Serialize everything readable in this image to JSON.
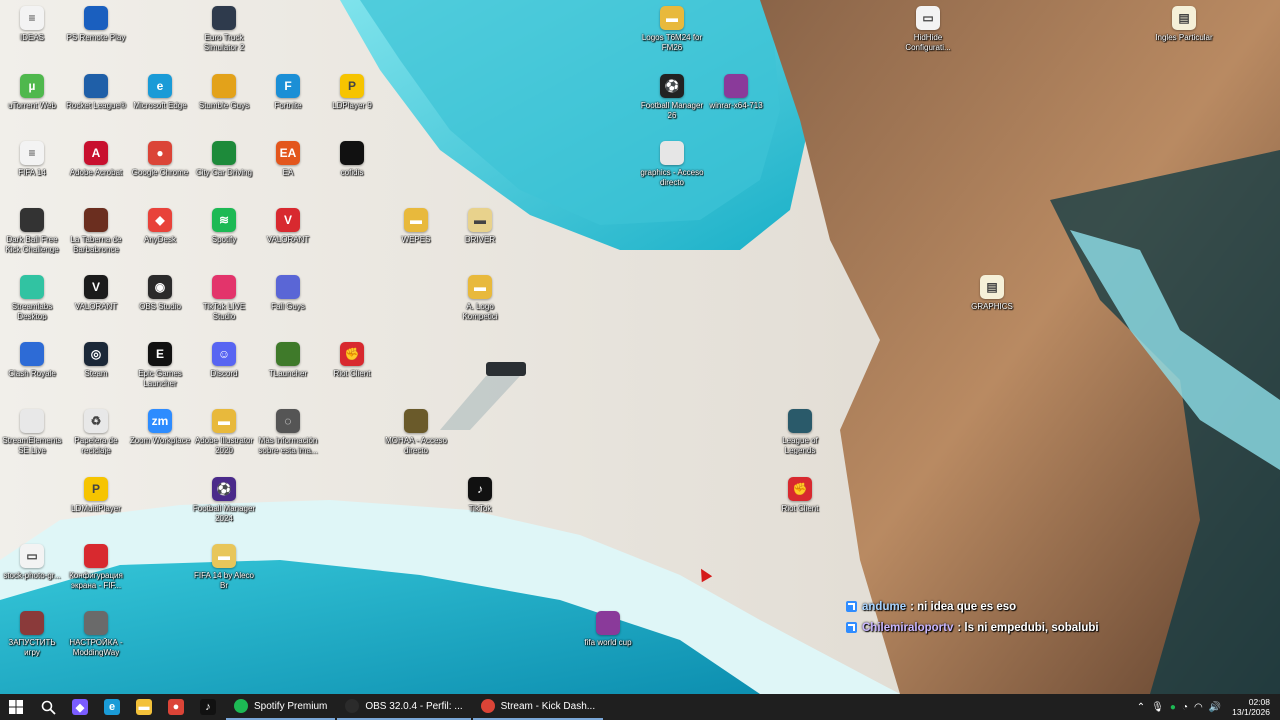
{
  "desktop": {
    "icons": [
      {
        "label": "IDEAS",
        "icon": "text-file-icon",
        "color": "#f3f3f3"
      },
      {
        "label": "PS Remote Play",
        "icon": "ps-remote-play-icon",
        "color": "#1a5fbf"
      },
      {
        "label": "Euro Truck Simulator 2",
        "icon": "euro-truck-icon",
        "color": "#2e3a4c"
      },
      {
        "label": "Logos T6M24 for FM26",
        "icon": "folder-icon",
        "color": "#e8b93c"
      },
      {
        "label": "HidHide Configurati...",
        "icon": "file-icon",
        "color": "#f3f3f3"
      },
      {
        "label": "Ingles Particular",
        "icon": "document-icon",
        "color": "#f5f0d8"
      },
      {
        "label": "uTorrent Web",
        "icon": "utorrent-icon",
        "color": "#4fb84d"
      },
      {
        "label": "Rocket League®",
        "icon": "rocket-league-icon",
        "color": "#1f5fa8"
      },
      {
        "label": "Microsoft Edge",
        "icon": "edge-icon",
        "color": "#1a9bd7"
      },
      {
        "label": "Stumble Guys",
        "icon": "stumble-guys-icon",
        "color": "#e3a21a"
      },
      {
        "label": "Fortnite",
        "icon": "fortnite-icon",
        "color": "#1b8fd6"
      },
      {
        "label": "LDPlayer 9",
        "icon": "ldplayer-icon",
        "color": "#f6c400"
      },
      {
        "label": "Football Manager 26",
        "icon": "football-manager-icon",
        "color": "#222222"
      },
      {
        "label": "winrar-x64-713",
        "icon": "winrar-icon",
        "color": "#8a3a9a"
      },
      {
        "label": "FIFA 14",
        "icon": "text-file-icon",
        "color": "#f3f3f3"
      },
      {
        "label": "Adobe Acrobat",
        "icon": "acrobat-icon",
        "color": "#c8102e"
      },
      {
        "label": "Google Chrome",
        "icon": "chrome-icon",
        "color": "#db4437"
      },
      {
        "label": "City Car Driving",
        "icon": "city-car-icon",
        "color": "#1d8a3a"
      },
      {
        "label": "EA",
        "icon": "ea-icon",
        "color": "#e3561c"
      },
      {
        "label": "cofidis",
        "icon": "phone-file-icon",
        "color": "#111111"
      },
      {
        "label": "graphics - Acceso directo",
        "icon": "shortcut-icon",
        "color": "#e6e6e6"
      },
      {
        "label": "Dark Ball Free Kick Challenge",
        "icon": "ball-icon",
        "color": "#333333"
      },
      {
        "label": "La Taberna de Barbabronce",
        "icon": "taberna-icon",
        "color": "#6b2e1f"
      },
      {
        "label": "AnyDesk",
        "icon": "anydesk-icon",
        "color": "#e8423a"
      },
      {
        "label": "Spotify",
        "icon": "spotify-icon",
        "color": "#1db954"
      },
      {
        "label": "VALORANT",
        "icon": "valorant-icon",
        "color": "#d8292f"
      },
      {
        "label": "WEPES",
        "icon": "folder-icon",
        "color": "#e8b93c"
      },
      {
        "label": "DRIVER",
        "icon": "folder-icon",
        "color": "#e8d28c"
      },
      {
        "label": "Streamlabs Desktop",
        "icon": "streamlabs-icon",
        "color": "#31c3a2"
      },
      {
        "label": "VALORANT",
        "icon": "valorant-icon",
        "color": "#1b1b1b"
      },
      {
        "label": "OBS Studio",
        "icon": "obs-icon",
        "color": "#2b2b2b"
      },
      {
        "label": "TikTok LIVE Studio",
        "icon": "tiktok-live-icon",
        "color": "#e3346b"
      },
      {
        "label": "Fall Guys",
        "icon": "fall-guys-icon",
        "color": "#5a66d6"
      },
      {
        "label": "A. Logo Kompetici",
        "icon": "folder-icon",
        "color": "#e8b93c"
      },
      {
        "label": "GRAPHICS",
        "icon": "document-icon",
        "color": "#f5f0d8"
      },
      {
        "label": "Clash Royale",
        "icon": "clash-royale-icon",
        "color": "#2d6bd6"
      },
      {
        "label": "Steam",
        "icon": "steam-icon",
        "color": "#1b2838"
      },
      {
        "label": "Epic Games Launcher",
        "icon": "epic-games-icon",
        "color": "#111111"
      },
      {
        "label": "Discord",
        "icon": "discord-icon",
        "color": "#5865f2"
      },
      {
        "label": "TLauncher",
        "icon": "tlauncher-icon",
        "color": "#3f7a2a"
      },
      {
        "label": "Riot Client",
        "icon": "riot-client-icon",
        "color": "#d8292f"
      },
      {
        "label": "StreamElements SE.Live",
        "icon": "streamelements-icon",
        "color": "#e8e8e8"
      },
      {
        "label": "Papelera de reciclaje",
        "icon": "recycle-bin-icon",
        "color": "#e8e8e8"
      },
      {
        "label": "Zoom Workplace",
        "icon": "zoom-icon",
        "color": "#2d8cff"
      },
      {
        "label": "Adobe Illustrator 2020",
        "icon": "folder-icon",
        "color": "#e8b93c"
      },
      {
        "label": "Más información sobre esta ima...",
        "icon": "camera-icon",
        "color": "#555555"
      },
      {
        "label": "MOHAA - Acceso directo",
        "icon": "mohaa-icon",
        "color": "#6a5a2a"
      },
      {
        "label": "League of Legends",
        "icon": "league-icon",
        "color": "#2a5a6a"
      },
      {
        "label": "LDMultiPlayer",
        "icon": "ldmultiplayer-icon",
        "color": "#f6c400"
      },
      {
        "label": "Football Manager 2024",
        "icon": "football-manager-icon",
        "color": "#4a2a8a"
      },
      {
        "label": "TikTok",
        "icon": "tiktok-icon",
        "color": "#111111"
      },
      {
        "label": "Riot Client",
        "icon": "riot-client-icon",
        "color": "#d8292f"
      },
      {
        "label": "stock-photo-gr...",
        "icon": "file-icon",
        "color": "#f3f3f3"
      },
      {
        "label": "Конфигурация экрана - FIF...",
        "icon": "fifa-config-icon",
        "color": "#d8292f"
      },
      {
        "label": "FIFA 14 by Aleco Br",
        "icon": "folder-icon",
        "color": "#e8c65a"
      },
      {
        "label": "ЗАПУСТИТЬ игру",
        "icon": "launch-game-icon",
        "color": "#8a3a3a"
      },
      {
        "label": "НАСТРОЙКА - ModdingWay",
        "icon": "settings-app-icon",
        "color": "#6a6a6a"
      },
      {
        "label": "fifa world cup",
        "icon": "archive-icon",
        "color": "#8a3a9a"
      }
    ]
  },
  "chat": [
    {
      "user": "andume",
      "message": "ni idea que es eso"
    },
    {
      "user": "Chilemiraloportv",
      "message": "ls ni empedubi, sobalubi"
    }
  ],
  "taskbar": {
    "start_icon": "windows-start-icon",
    "search_icon": "search-icon",
    "pinned": [
      {
        "name": "copilot-icon",
        "color": "#7a5cff",
        "glyph": "◆"
      },
      {
        "name": "edge-icon",
        "color": "#1a9bd7",
        "glyph": "e"
      },
      {
        "name": "file-explorer-icon",
        "color": "#f3c13a",
        "glyph": "▬"
      },
      {
        "name": "chrome-icon",
        "color": "#db4437",
        "glyph": "●"
      },
      {
        "name": "tiktok-icon",
        "color": "#111111",
        "glyph": "♪"
      }
    ],
    "apps": [
      {
        "label": "Spotify Premium",
        "icon": "spotify-icon",
        "color": "#1db954"
      },
      {
        "label": "OBS 32.0.4 - Perfil: ...",
        "icon": "obs-icon",
        "color": "#2b2b2b"
      },
      {
        "label": "Stream - Kick Dash...",
        "icon": "chrome-icon",
        "color": "#db4437"
      }
    ],
    "tray": {
      "time": "02:08",
      "date": "13/1/2026"
    }
  }
}
